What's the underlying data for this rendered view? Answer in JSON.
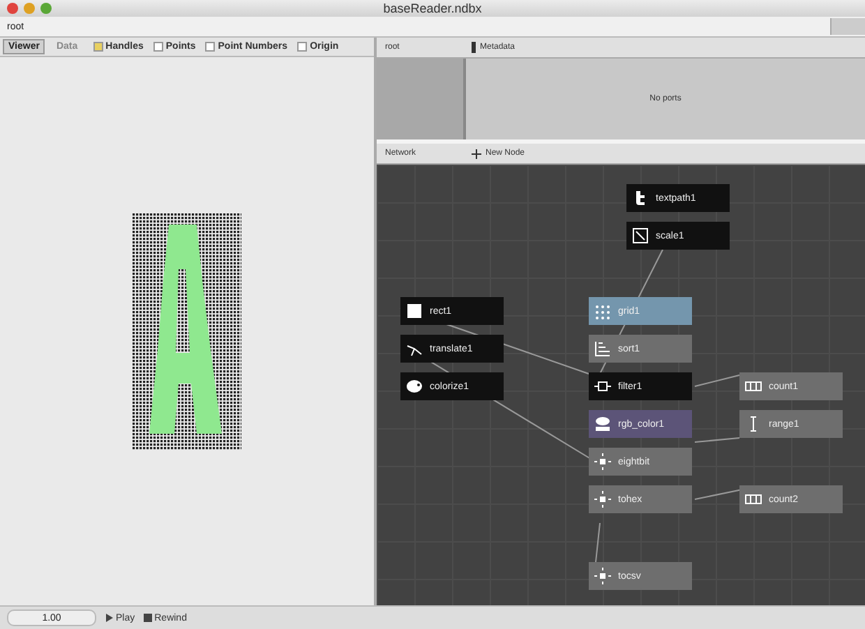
{
  "window": {
    "title": "baseReader.ndbx"
  },
  "path_bar": {
    "crumb": "root"
  },
  "viewer": {
    "tabs": [
      {
        "label": "Viewer",
        "selected": true
      },
      {
        "label": "Data",
        "selected": false
      }
    ],
    "options": [
      {
        "label": "Handles",
        "checked": true
      },
      {
        "label": "Points",
        "checked": false
      },
      {
        "label": "Point Numbers",
        "checked": false
      },
      {
        "label": "Origin",
        "checked": false
      }
    ]
  },
  "ports_panel": {
    "node": "root",
    "metadata": "Metadata",
    "message": "No ports"
  },
  "network": {
    "title": "Network",
    "new_node": "New Node",
    "nodes": [
      {
        "label": "textpath1",
        "kind": "text",
        "color": "#111111"
      },
      {
        "label": "scale1",
        "kind": "scale",
        "color": "#111111"
      },
      {
        "label": "rect1",
        "kind": "rect",
        "color": "#111111"
      },
      {
        "label": "translate1",
        "kind": "translate",
        "color": "#111111"
      },
      {
        "label": "colorize1",
        "kind": "colorize",
        "color": "#111111"
      },
      {
        "label": "grid1",
        "kind": "grid",
        "color": "#7496ad"
      },
      {
        "label": "sort1",
        "kind": "sort",
        "color": "#6e6e6e"
      },
      {
        "label": "filter1",
        "kind": "filter",
        "color": "#111111"
      },
      {
        "label": "rgb_color1",
        "kind": "rgb",
        "color": "#5c5478"
      },
      {
        "label": "eightbit",
        "kind": "convert",
        "color": "#6e6e6e"
      },
      {
        "label": "tohex",
        "kind": "convert",
        "color": "#6e6e6e"
      },
      {
        "label": "tocsv",
        "kind": "convert",
        "color": "#6e6e6e"
      },
      {
        "label": "count1",
        "kind": "count",
        "color": "#6e6e6e"
      },
      {
        "label": "range1",
        "kind": "range",
        "color": "#6e6e6e"
      },
      {
        "label": "count2",
        "kind": "count",
        "color": "#6e6e6e"
      }
    ]
  },
  "bottom_bar": {
    "frame": "1.00",
    "play": "Play",
    "rewind": "Rewind"
  }
}
